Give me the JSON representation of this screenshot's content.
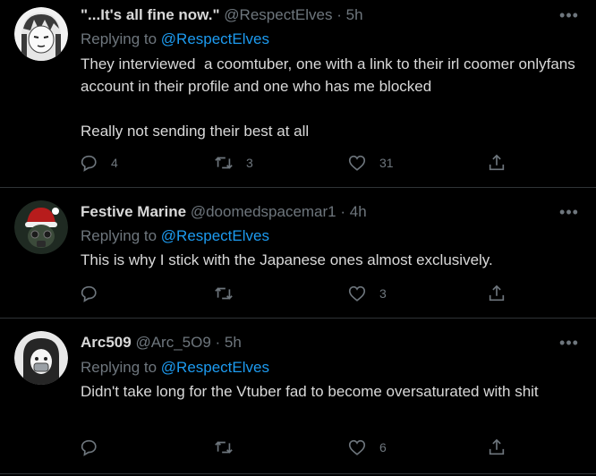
{
  "tweets": [
    {
      "name": "\"...It's all fine now.\"",
      "handle": "@RespectElves",
      "time": "· 5h",
      "replying_prefix": "Replying to ",
      "replying_to": "@RespectElves",
      "text": "They interviewed  a coomtuber, one with a link to their irl coomer onlyfans account in their profile and one who has me blocked\n\nReally not sending their best at all",
      "replies": "4",
      "retweets": "3",
      "likes": "31",
      "more": "•••"
    },
    {
      "name": "Festive Marine",
      "handle": "@doomedspacemar1",
      "time": "· 4h",
      "replying_prefix": "Replying to ",
      "replying_to": "@RespectElves",
      "text": "This is why I stick with the Japanese ones almost exclusively.",
      "replies": "",
      "retweets": "",
      "likes": "3",
      "more": "•••"
    },
    {
      "name": "Arc509",
      "handle": "@Arc_5O9",
      "time": "· 5h",
      "replying_prefix": "Replying to ",
      "replying_to": "@RespectElves",
      "text": "Didn't take long for the Vtuber fad to become oversaturated with shit",
      "replies": "",
      "retweets": "",
      "likes": "6",
      "more": "•••"
    }
  ],
  "colors": {
    "background": "#000000",
    "text": "#d9d9d9",
    "muted": "#6e767d",
    "link": "#1d9bf0",
    "divider": "#2f3336"
  },
  "icons": [
    "reply-icon",
    "retweet-icon",
    "like-icon",
    "share-icon",
    "more-icon"
  ]
}
